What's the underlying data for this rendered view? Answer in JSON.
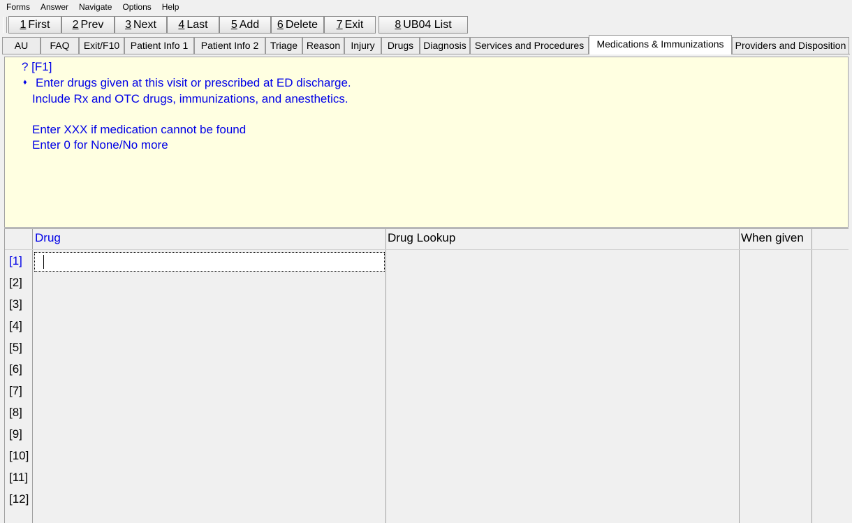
{
  "menu": [
    "Forms",
    "Answer",
    "Navigate",
    "Options",
    "Help"
  ],
  "toolbar": {
    "buttons": [
      {
        "key": "1",
        "label": "First"
      },
      {
        "key": "2",
        "label": "Prev"
      },
      {
        "key": "3",
        "label": "Next"
      },
      {
        "key": "4",
        "label": "Last"
      },
      {
        "key": "5",
        "label": "Add"
      },
      {
        "key": "6",
        "label": "Delete"
      },
      {
        "key": "7",
        "label": "Exit"
      },
      {
        "key": "8",
        "label": "UB04 List"
      }
    ]
  },
  "tabs": [
    "AU",
    "FAQ",
    "Exit/F10",
    "Patient Info 1",
    "Patient Info 2",
    "Triage",
    "Reason",
    "Injury",
    "Drugs",
    "Diagnosis",
    "Services and Procedures",
    "Medications & Immunizations",
    "Providers and Disposition"
  ],
  "active_tab": "Medications & Immunizations",
  "help": {
    "hotkey": "? [F1]",
    "bullet": "♦",
    "line1": "Enter drugs given at this visit or prescribed at ED discharge.",
    "line2": "Include Rx and OTC drugs, immunizations, and anesthetics.",
    "line3": "Enter XXX if medication cannot be found",
    "line4": "Enter 0 for None/No more"
  },
  "grid": {
    "columns": [
      "Drug",
      "Drug Lookup",
      "When given"
    ],
    "rows": [
      "[1]",
      "[2]",
      "[3]",
      "[4]",
      "[5]",
      "[6]",
      "[7]",
      "[8]",
      "[9]",
      "[10]",
      "[11]",
      "[12]"
    ],
    "drug_value": ""
  }
}
